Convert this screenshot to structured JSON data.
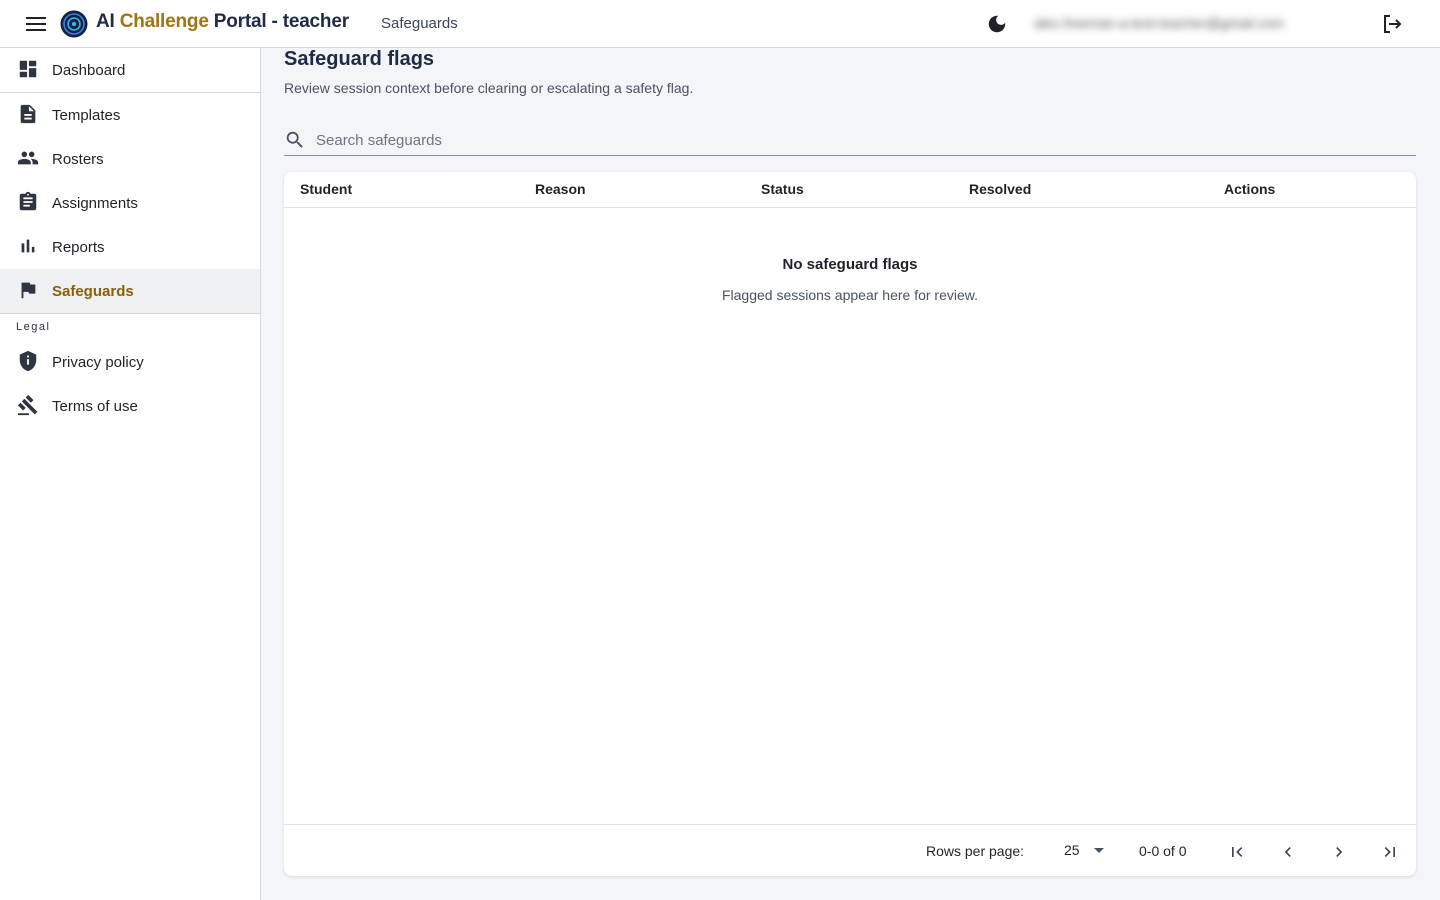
{
  "header": {
    "title_prefix": "AI ",
    "title_accent": "Challenge",
    "title_suffix": " Portal - teacher",
    "breadcrumb": "Safeguards",
    "user_email": "alex.freeman-a-test-teacher@gmail.com",
    "icons": [
      "menu-icon",
      "logo-icon",
      "dark-mode-icon",
      "logout-icon"
    ]
  },
  "sidebar": {
    "items": [
      {
        "label": "Dashboard",
        "icon": "dashboard-icon"
      },
      {
        "label": "Templates",
        "icon": "document-icon"
      },
      {
        "label": "Rosters",
        "icon": "people-icon"
      },
      {
        "label": "Assignments",
        "icon": "clipboard-icon"
      },
      {
        "label": "Reports",
        "icon": "bar-chart-icon"
      },
      {
        "label": "Safeguards",
        "icon": "flag-icon",
        "active": true
      }
    ],
    "legal_label": "Legal",
    "legal_items": [
      {
        "label": "Privacy policy",
        "icon": "shield-icon"
      },
      {
        "label": "Terms of use",
        "icon": "gavel-icon"
      }
    ]
  },
  "main": {
    "title": "Safeguard flags",
    "subtitle": "Review session context before clearing or escalating a safety flag.",
    "search_placeholder": "Search safeguards",
    "search_value": "",
    "columns": [
      "Student",
      "Reason",
      "Status",
      "Resolved",
      "Actions"
    ],
    "empty_title": "No safeguard flags",
    "empty_subtitle": "Flagged sessions appear here for review.",
    "footer": {
      "rows_per_page_label": "Rows per page:",
      "rows_per_page_value": "25",
      "range": "0-0 of 0"
    }
  },
  "colors": {
    "accent": "#a07414",
    "active_nav_text": "#8a5f06",
    "active_nav_bg": "#eef0f3",
    "page_bg": "#f4f5f8"
  }
}
